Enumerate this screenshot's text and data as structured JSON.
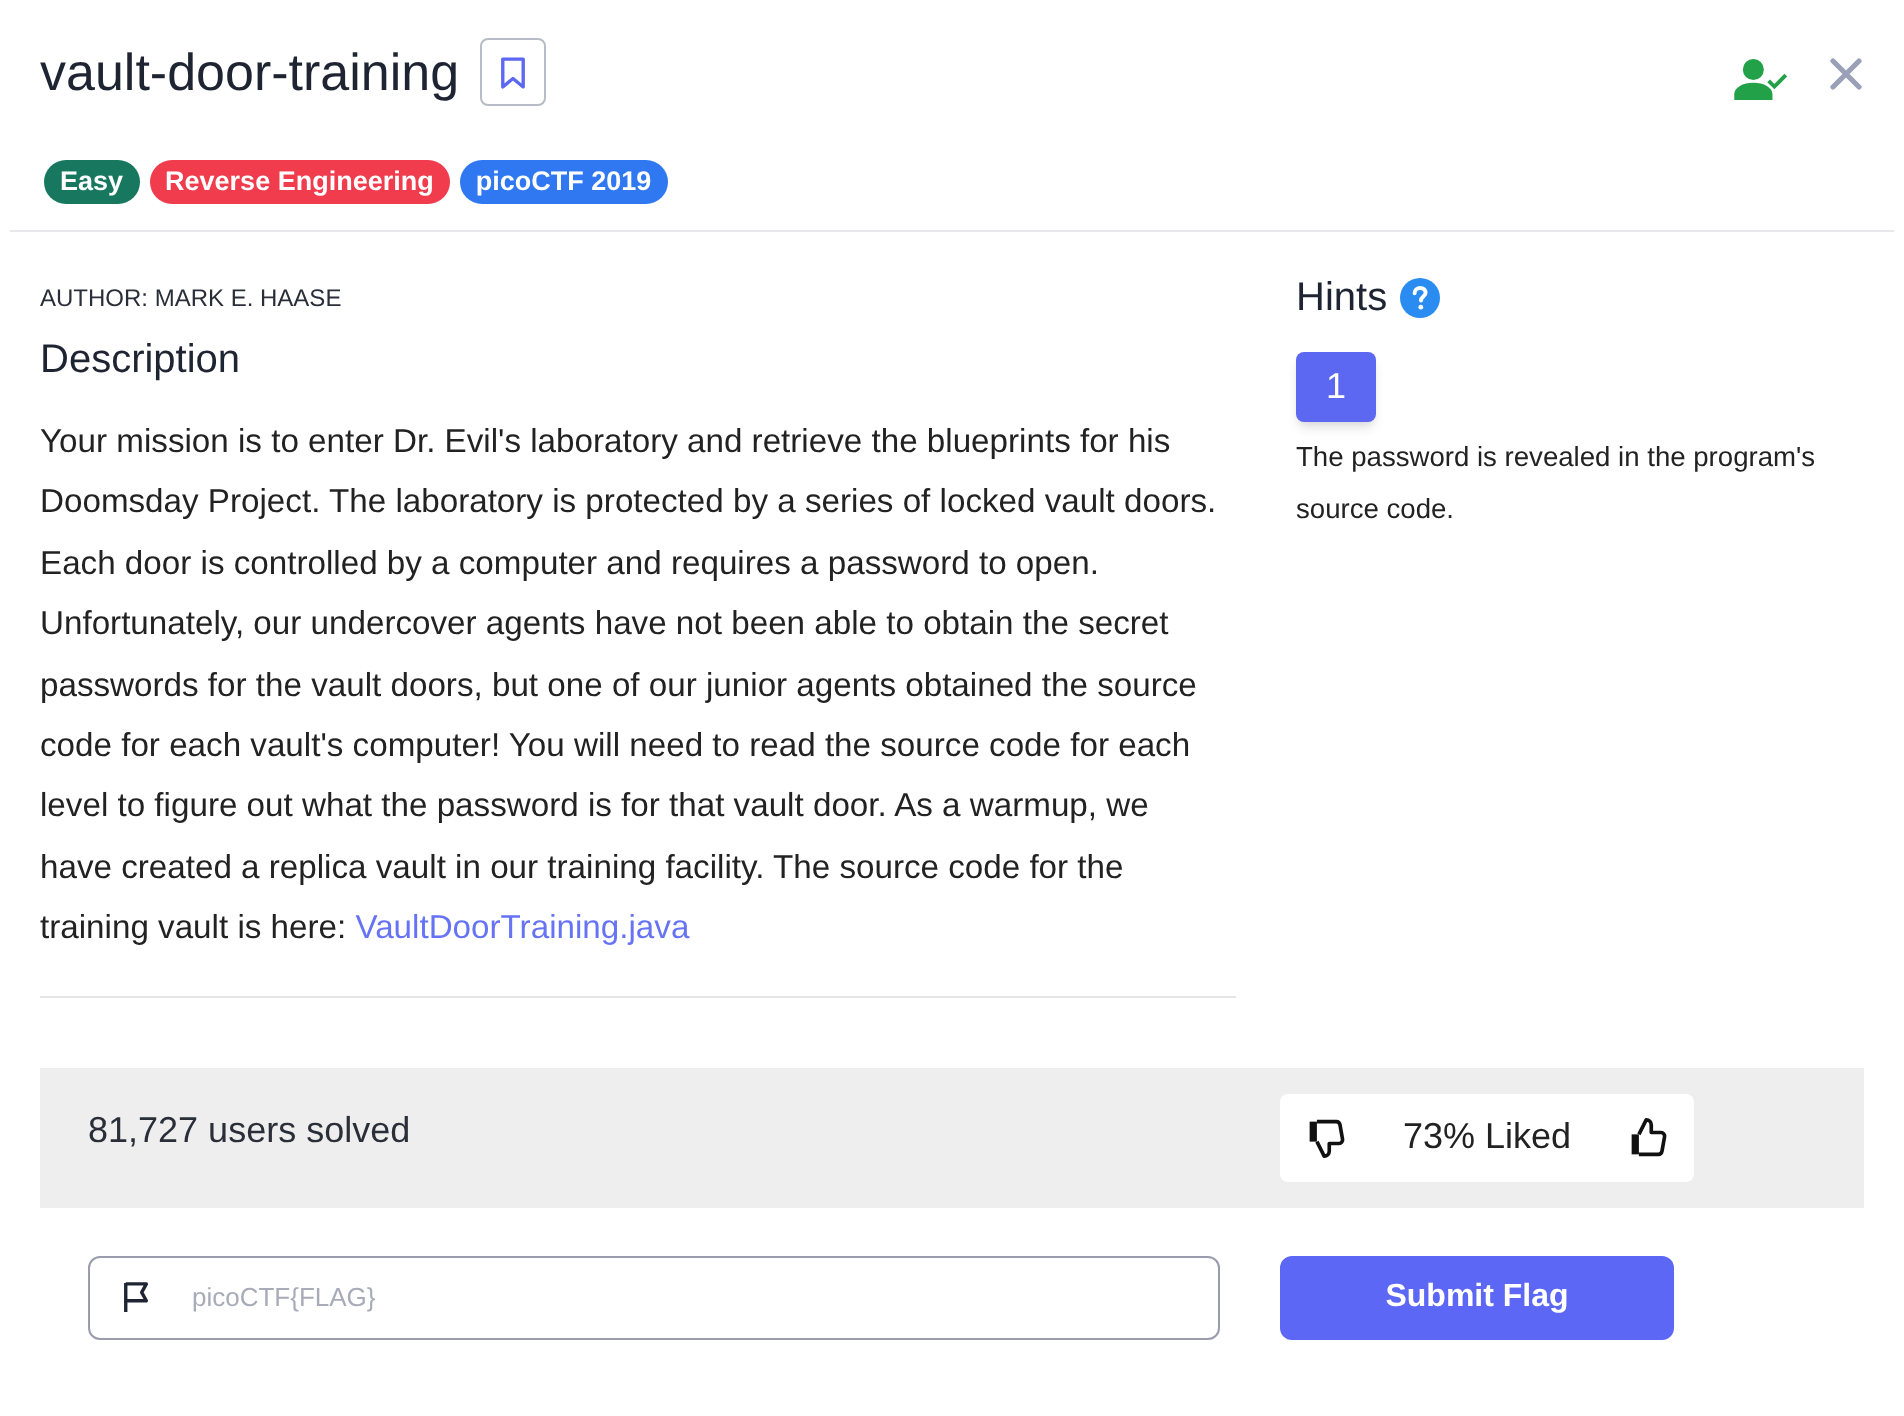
{
  "header": {
    "title": "vault-door-training",
    "bookmarked": false,
    "solved": true
  },
  "tags": [
    {
      "label": "Easy",
      "color": "#17775f"
    },
    {
      "label": "Reverse Engineering",
      "color": "#f03c4c"
    },
    {
      "label": "picoCTF 2019",
      "color": "#2f78f2"
    }
  ],
  "author": "AUTHOR: MARK E. HAASE",
  "description": {
    "heading": "Description",
    "text": "Your mission is to enter Dr. Evil's laboratory and retrieve the blueprints for his Doomsday Project. The laboratory is protected by a series of locked vault doors. Each door is controlled by a computer and requires a password to open. Unfortunately, our undercover agents have not been able to obtain the secret passwords for the vault doors, but one of our junior agents obtained the source code for each vault's computer! You will need to read the source code for each level to figure out what the password is for that vault door. As a warmup, we have created a replica vault in our training facility. The source code for the training vault is here:",
    "link": "VaultDoorTraining.java"
  },
  "hints": {
    "heading": "Hints",
    "items": [
      {
        "label": "1",
        "selected": true,
        "text": "The password is revealed in the program's source code."
      }
    ]
  },
  "stats": {
    "solved": "81,727 users solved",
    "liked": "73% Liked"
  },
  "flag_form": {
    "placeholder": "picoCTF{FLAG}",
    "submit": "Submit Flag"
  }
}
